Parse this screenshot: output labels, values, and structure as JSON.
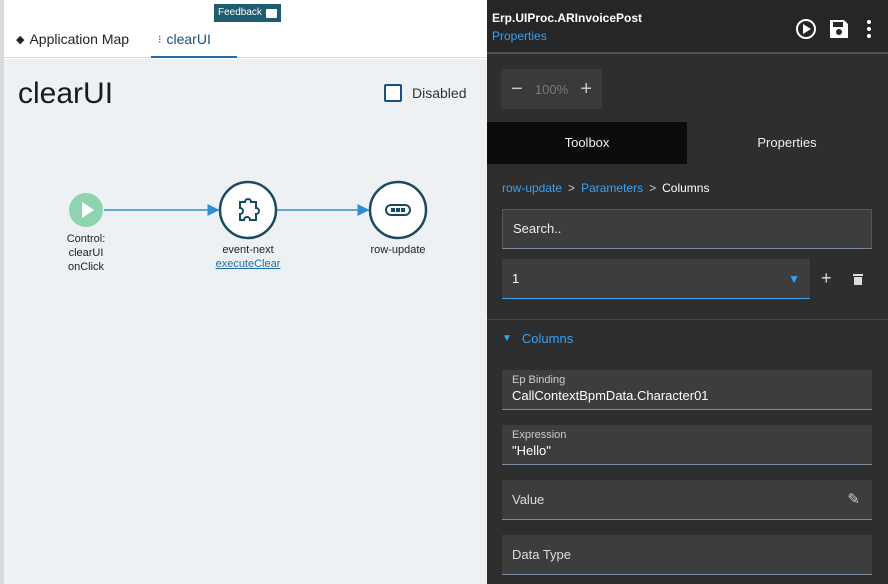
{
  "feedback": {
    "label": "Feedback"
  },
  "tabs": [
    {
      "label": "Application Map"
    },
    {
      "label": "clearUI"
    }
  ],
  "canvas": {
    "title": "clearUI",
    "disabled_label": "Disabled",
    "nodes": [
      {
        "label_lines": [
          "Control:",
          "clearUI",
          "onClick"
        ],
        "icon": "play-icon",
        "color": "#8fd3b0"
      },
      {
        "label": "event-next",
        "link": "executeClear",
        "icon": "puzzle-icon"
      },
      {
        "label": "row-update",
        "icon": "row-update-icon"
      }
    ],
    "colors": {
      "node_stroke": "#1a4a5e",
      "connector": "#2d8fd4",
      "start": "#8fd3b0"
    }
  },
  "right": {
    "title": "Erp.UIProc.ARInvoicePost",
    "subtitle": "Properties",
    "zoom": "100%",
    "tabs": [
      {
        "label": "Toolbox"
      },
      {
        "label": "Properties"
      }
    ],
    "breadcrumb": [
      "row-update",
      "Parameters",
      "Columns"
    ],
    "breadcrumb_sep": ">",
    "search_placeholder": "Search..",
    "select_value": "1",
    "section_title": "Columns",
    "fields": [
      {
        "label": "Ep Binding",
        "value": "CallContextBpmData.Character01"
      },
      {
        "label": "Expression",
        "value": "\"Hello\""
      },
      {
        "label": "Value"
      },
      {
        "label": "Data Type"
      }
    ]
  }
}
